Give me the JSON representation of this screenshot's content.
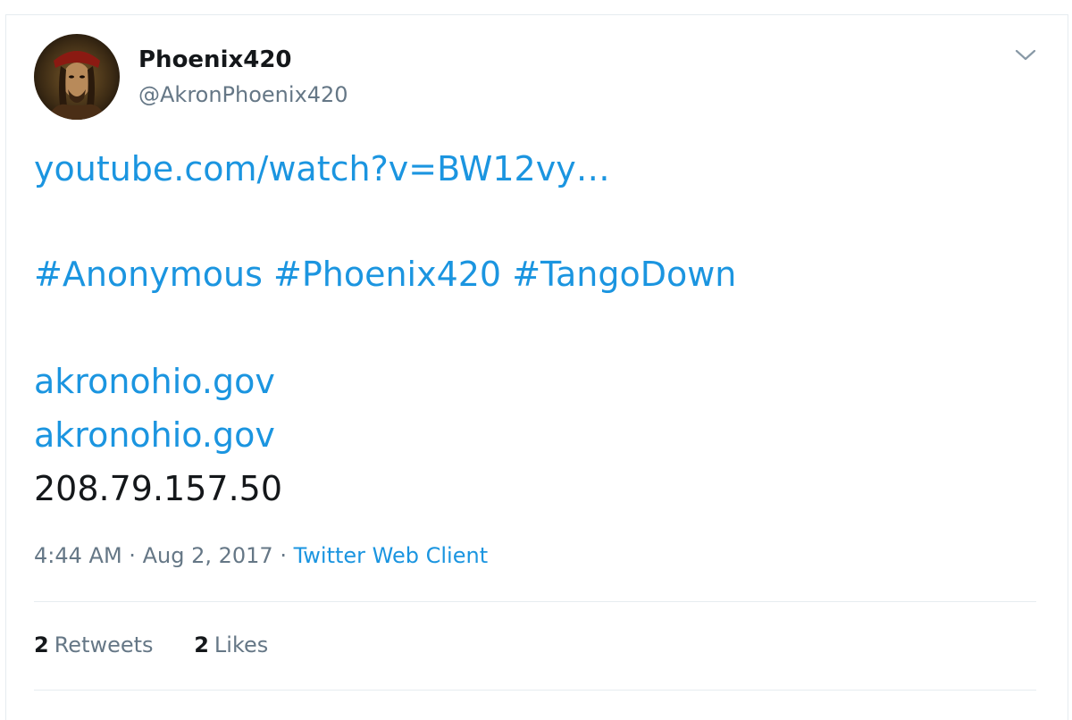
{
  "tweet": {
    "author": {
      "display_name": "Phoenix420",
      "handle": "@AkronPhoenix420"
    },
    "lines": {
      "url": "youtube.com/watch?v=BW12vy…",
      "hashtags": [
        "#Anonymous",
        "#Phoenix420",
        "#TangoDown"
      ],
      "domain_1": "akronohio.gov",
      "domain_2": "akronohio.gov",
      "ip": "208.79.157.50"
    },
    "time": "4:44 AM",
    "sep_1": "·",
    "date": "Aug 2, 2017",
    "sep_2": "·",
    "source": "Twitter Web Client",
    "stats": {
      "retweets_count": "2",
      "retweets_label": "Retweets",
      "likes_count": "2",
      "likes_label": "Likes"
    }
  },
  "colors": {
    "link": "#1b95e0",
    "text": "#14171a",
    "muted": "#657786",
    "divider": "#e6ecf0"
  },
  "icons": {
    "menu": "chevron-down-icon",
    "avatar": "pirate-avatar"
  }
}
